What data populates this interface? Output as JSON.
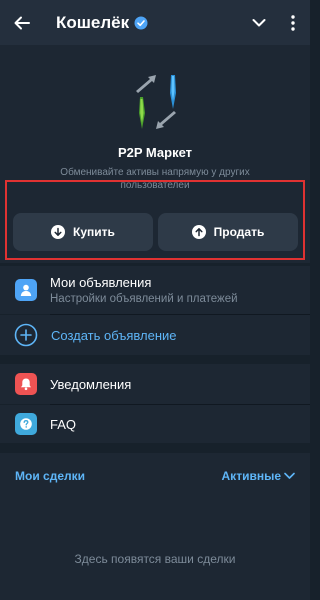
{
  "header": {
    "title": "Кошелёк",
    "back_icon": "arrow-left-icon",
    "verified_icon": "verified-badge-icon",
    "chevron_icon": "chevron-down-icon",
    "menu_icon": "more-vertical-icon"
  },
  "hero": {
    "title": "P2P Маркет",
    "subtitle": "Обменивайте активы напрямую у других пользователей"
  },
  "actions": {
    "buy_label": "Купить",
    "buy_icon": "arrow-down-circle-icon",
    "sell_label": "Продать",
    "sell_icon": "arrow-up-circle-icon"
  },
  "menu": {
    "my_ads": {
      "title": "Мои объявления",
      "subtitle": "Настройки объявлений и платежей",
      "icon": "user-icon",
      "icon_color": "#4ea4f6"
    },
    "create_ad": {
      "title": "Создать объявление",
      "icon": "plus-circle-icon"
    },
    "notifications": {
      "title": "Уведомления",
      "icon": "bell-icon",
      "icon_color": "#ee5353"
    },
    "faq": {
      "title": "FAQ",
      "icon": "question-icon",
      "icon_color": "#3fa9dc"
    }
  },
  "deals": {
    "title": "Мои сделки",
    "filter_label": "Активные",
    "empty_text": "Здесь появятся ваши сделки"
  },
  "colors": {
    "background": "#17212b",
    "panel": "#1d2733",
    "header": "#242f3d",
    "accent": "#5eb5f7",
    "highlight_frame": "#e03232"
  }
}
